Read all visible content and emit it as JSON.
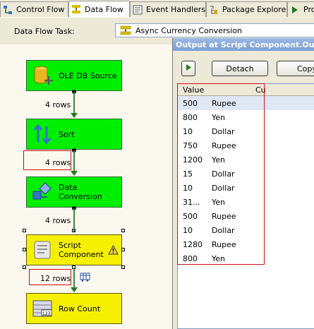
{
  "tabs": [
    {
      "label": "Control Flow",
      "icon": "control-flow-icon"
    },
    {
      "label": "Data Flow",
      "icon": "data-flow-icon",
      "active": true
    },
    {
      "label": "Event Handlers",
      "icon": "event-handlers-icon"
    },
    {
      "label": "Package Explorer",
      "icon": "package-explorer-icon"
    },
    {
      "label": "Pro",
      "icon": "progress-icon"
    }
  ],
  "task": {
    "label": "Data Flow Task:",
    "value": "Async Currency Conversion"
  },
  "components": [
    {
      "name": "OLE DB Source",
      "line1": "OLE DB Source",
      "line2": "",
      "icon": "database-icon"
    },
    {
      "name": "Sort",
      "line1": "Sort",
      "line2": "",
      "icon": "sort-icon"
    },
    {
      "name": "Data Conversion",
      "line1": "Data",
      "line2": "Conversion",
      "icon": "data-conversion-icon"
    },
    {
      "name": "Script Component",
      "line1": "Script",
      "line2": "Component",
      "icon": "script-icon",
      "warning": true
    },
    {
      "name": "Row Count",
      "line1": "Row Count",
      "line2": "",
      "icon": "row-count-icon"
    }
  ],
  "connectors": [
    {
      "label": "4 rows"
    },
    {
      "label": "4 rows"
    },
    {
      "label": "4 rows"
    },
    {
      "label": "12 rows"
    }
  ],
  "output": {
    "title": "Output at Script Component.Output",
    "detach_label": "Detach",
    "copy_label": "Copy",
    "columns": [
      "Value",
      "Cu"
    ],
    "rows": [
      [
        "500",
        "Rupee"
      ],
      [
        "800",
        "Yen"
      ],
      [
        "10",
        "Dollar"
      ],
      [
        "750",
        "Rupee"
      ],
      [
        "1200",
        "Yen"
      ],
      [
        "15",
        "Dollar"
      ],
      [
        "10",
        "Dollar"
      ],
      [
        "31...",
        "Yen"
      ],
      [
        "500",
        "Rupee"
      ],
      [
        "10",
        "Dollar"
      ],
      [
        "1280",
        "Rupee"
      ],
      [
        "800",
        "Yen"
      ]
    ]
  },
  "colors": {
    "component_green": "#00ee00",
    "component_yellow": "#f5f000",
    "connector_green": "#1d7a1d",
    "highlight_red": "#d01010",
    "title_blue": "#7b9fd6"
  }
}
